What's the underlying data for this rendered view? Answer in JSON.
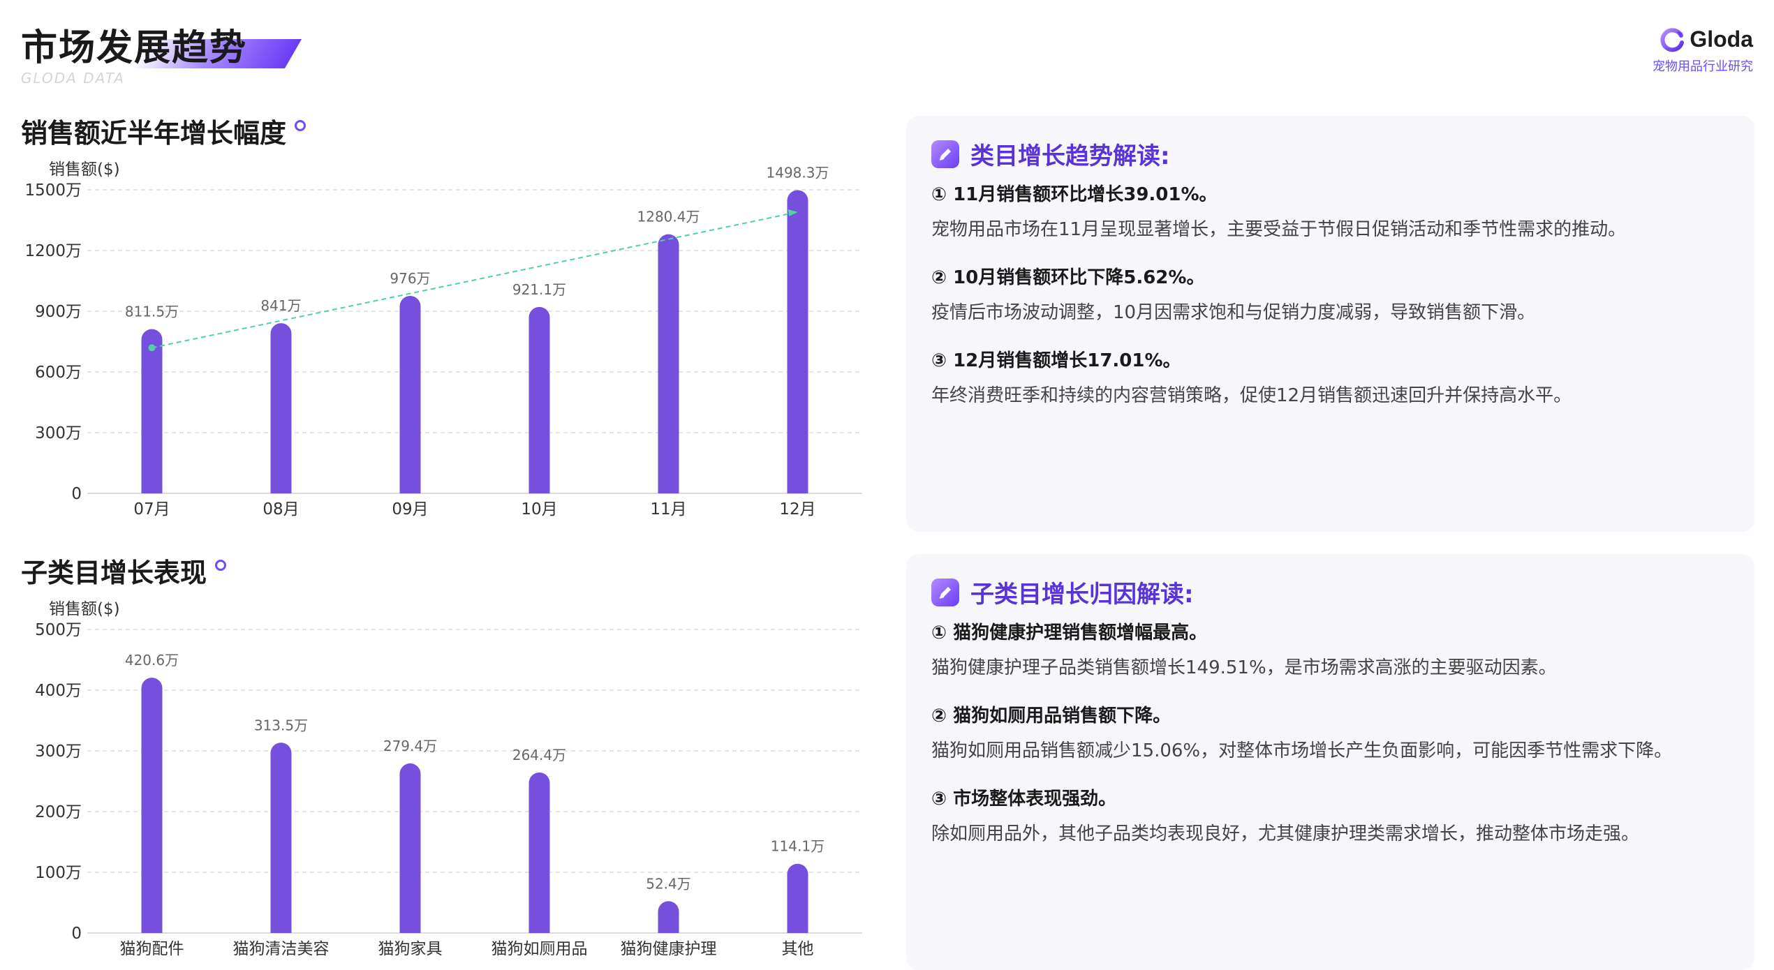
{
  "header": {
    "title": "市场发展趋势",
    "subtitle": "GLODA DATA"
  },
  "brand": {
    "name": "Gloda",
    "subtitle": "宠物用品行业研究"
  },
  "colors": {
    "bar": "#7550dd",
    "accent": "#6a4cff",
    "trendline": "#4fd1a0"
  },
  "section1": {
    "title": "销售额近半年增长幅度"
  },
  "section2": {
    "title": "子类目增长表现"
  },
  "chart_data": [
    {
      "type": "bar",
      "ylabel": "销售额($)",
      "categories": [
        "07月",
        "08月",
        "09月",
        "10月",
        "11月",
        "12月"
      ],
      "values": [
        811.5,
        841,
        976,
        921.1,
        1280.4,
        1498.3
      ],
      "value_labels": [
        "811.5万",
        "841万",
        "976万",
        "921.1万",
        "1280.4万",
        "1498.3万"
      ],
      "yticks": [
        0,
        300,
        600,
        900,
        1200,
        1500
      ],
      "ytick_labels": [
        "0",
        "300万",
        "600万",
        "900万",
        "1200万",
        "1500万"
      ],
      "ylim": [
        0,
        1500
      ],
      "grid": true,
      "trendline": true
    },
    {
      "type": "bar",
      "ylabel": "销售额($)",
      "categories": [
        "猫狗配件",
        "猫狗清洁美容",
        "猫狗家具",
        "猫狗如厕用品",
        "猫狗健康护理",
        "其他"
      ],
      "values": [
        420.6,
        313.5,
        279.4,
        264.4,
        52.4,
        114.1
      ],
      "value_labels": [
        "420.6万",
        "313.5万",
        "279.4万",
        "264.4万",
        "52.4万",
        "114.1万"
      ],
      "yticks": [
        0,
        100,
        200,
        300,
        400,
        500
      ],
      "ytick_labels": [
        "0",
        "100万",
        "200万",
        "300万",
        "400万",
        "500万"
      ],
      "ylim": [
        0,
        500
      ],
      "grid": true
    }
  ],
  "card1": {
    "title": "类目增长趋势解读:",
    "points": [
      {
        "heading": "① 11月销售额环比增长39.01%。",
        "text": "宠物用品市场在11月呈现显著增长，主要受益于节假日促销活动和季节性需求的推动。"
      },
      {
        "heading": "② 10月销售额环比下降5.62%。",
        "text": "疫情后市场波动调整，10月因需求饱和与促销力度减弱，导致销售额下滑。"
      },
      {
        "heading": "③ 12月销售额增长17.01%。",
        "text": "年终消费旺季和持续的内容营销策略，促使12月销售额迅速回升并保持高水平。"
      }
    ]
  },
  "card2": {
    "title": "子类目增长归因解读:",
    "points": [
      {
        "heading": "① 猫狗健康护理销售额增幅最高。",
        "text": "猫狗健康护理子品类销售额增长149.51%，是市场需求高涨的主要驱动因素。"
      },
      {
        "heading": "② 猫狗如厕用品销售额下降。",
        "text": "猫狗如厕用品销售额减少15.06%，对整体市场增长产生负面影响，可能因季节性需求下降。"
      },
      {
        "heading": "③ 市场整体表现强劲。",
        "text": "除如厕用品外，其他子品类均表现良好，尤其健康护理类需求增长，推动整体市场走强。"
      }
    ]
  }
}
